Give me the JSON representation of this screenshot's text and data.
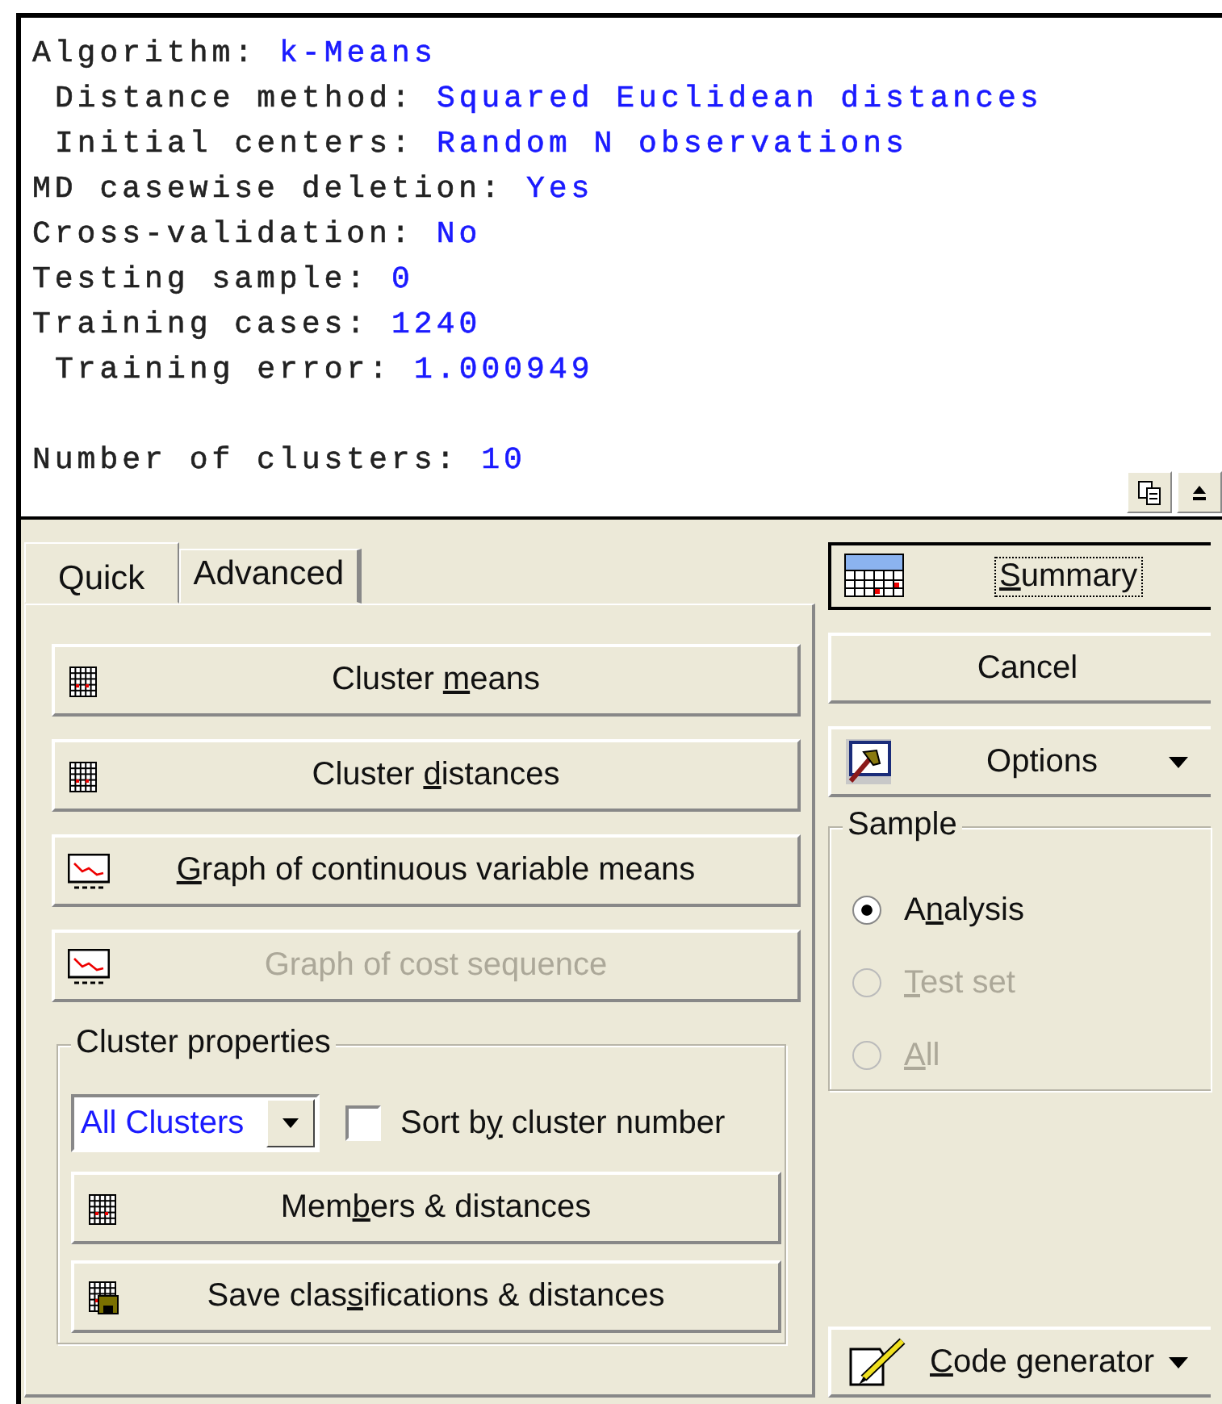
{
  "report_sections": [
    [
      {
        "label": "Algorithm:",
        "value": "k-Means",
        "indent": false
      },
      {
        "label": "Distance method:",
        "value": "Squared Euclidean distances",
        "indent": true
      },
      {
        "label": "Initial centers:",
        "value": "Random N observations",
        "indent": true
      },
      {
        "label": "MD casewise deletion:",
        "value": "Yes",
        "indent": false
      },
      {
        "label": "Cross-validation:",
        "value": "No",
        "indent": false
      },
      {
        "label": "Testing sample:",
        "value": "0",
        "indent": false
      },
      {
        "label": "Training cases:",
        "value": "1240",
        "indent": false
      },
      {
        "label": "Training error:",
        "value": "1.000949",
        "indent": true
      }
    ],
    [
      {
        "label": "Number of clusters:",
        "value": "10",
        "indent": false
      }
    ]
  ],
  "report_tools": [
    {
      "kind": "copy"
    },
    {
      "kind": "collapse"
    }
  ],
  "tabs": [
    {
      "label": "Quick",
      "selected": true
    },
    {
      "label": "Advanced",
      "selected": false
    }
  ],
  "quick_buttons": [
    {
      "kind": "grid",
      "label": {
        "before": "Cluster ",
        "key": "m",
        "after": "eans"
      },
      "disabled": false
    },
    {
      "kind": "grid",
      "label": {
        "before": "Cluster ",
        "key": "d",
        "after": "istances"
      },
      "disabled": false
    },
    {
      "kind": "graph",
      "label": {
        "key": "G",
        "after": "raph of continuous variable means"
      },
      "disabled": false
    },
    {
      "kind": "graph",
      "label": {
        "before": "Graph of cost sequence"
      },
      "disabled": true
    }
  ],
  "cluster_properties": {
    "title": "Cluster properties",
    "combo": {
      "value": "All Clusters"
    },
    "checkbox": {
      "label": {
        "before": "Sort b",
        "key": "y",
        "after": " cluster number"
      },
      "checked": false
    },
    "buttons": [
      {
        "kind": "grid",
        "label": {
          "before": "Mem",
          "key": "b",
          "after": "ers & distances"
        },
        "disabled": false
      },
      {
        "kind": "save",
        "label": {
          "before": "Save clas",
          "key": "s",
          "after": "ifications & distances"
        },
        "disabled": false
      }
    ]
  },
  "side_buttons": [
    {
      "kind": "summary",
      "label": {
        "key": "S",
        "after": "ummary"
      },
      "default": true
    },
    {
      "kind": "plain",
      "label": {
        "before": "Cancel"
      },
      "default": false
    },
    {
      "kind": "options",
      "label": {
        "before": "Options"
      },
      "default": false
    }
  ],
  "sample": {
    "title": "Sample",
    "options": [
      {
        "label": {
          "before": "A",
          "key": "n",
          "after": "alysis"
        },
        "selected": true,
        "disabled": false
      },
      {
        "label": {
          "key": "T",
          "after": "est set"
        },
        "selected": false,
        "disabled": true
      },
      {
        "label": {
          "key": "A",
          "after": "ll"
        },
        "selected": false,
        "disabled": true
      }
    ]
  },
  "code_generator": {
    "label": {
      "key": "C",
      "after": "ode generator"
    }
  }
}
